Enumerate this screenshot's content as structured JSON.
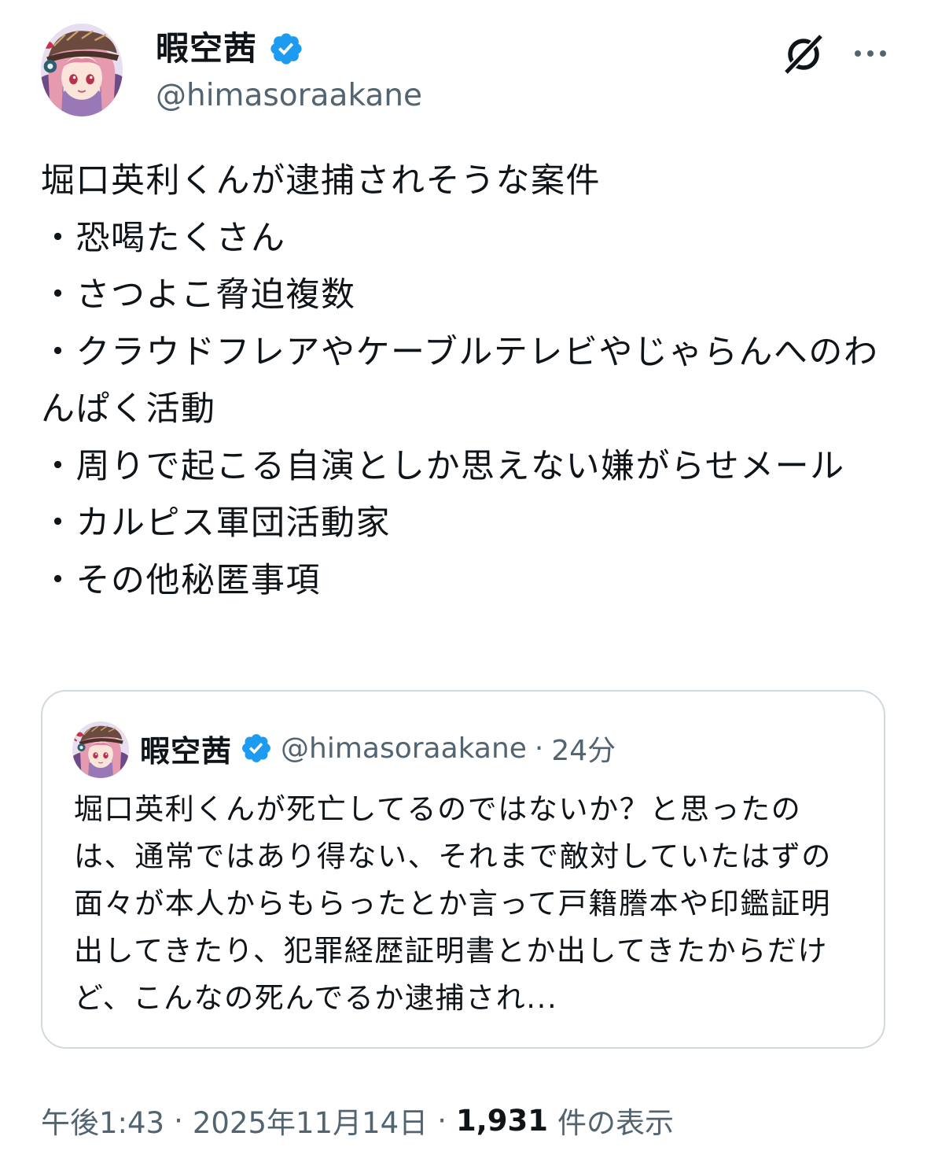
{
  "colors": {
    "text": "#0f1419",
    "secondary": "#536471",
    "verified": "#1d9bf0",
    "border": "#cfd9de",
    "background": "#ffffff"
  },
  "post": {
    "author": {
      "display_name": "暇空茜",
      "handle": "@himasoraakane",
      "verified": true
    },
    "icons": {
      "grok": "grok-icon",
      "more": "more-icon",
      "verified": "verified-icon"
    },
    "text": "堀口英利くんが逮捕されそうな案件\n・恐喝たくさん\n・さつよこ脅迫複数\n・クラウドフレアやケーブルテレビやじゃらんへのわんぱく活動\n・周りで起こる自演としか思えない嫌がらせメール\n・カルピス軍団活動家\n・その他秘匿事項"
  },
  "quote": {
    "author": {
      "display_name": "暇空茜",
      "handle": "@himasoraakane",
      "verified": true
    },
    "separator": "·",
    "time": "24分",
    "text": "堀口英利くんが死亡してるのではないか？と思ったのは、通常ではあり得ない、それまで敵対していたはずの面々が本人からもらったとか言って戸籍謄本や印鑑証明出してきたり、犯罪経歴証明書とか出してきたからだけど、こんなの死んでるか逮捕され..."
  },
  "meta": {
    "time": "午後1:43",
    "separator": "·",
    "date": "2025年11月14日",
    "views_count": "1,931",
    "views_label": "件の表示"
  }
}
